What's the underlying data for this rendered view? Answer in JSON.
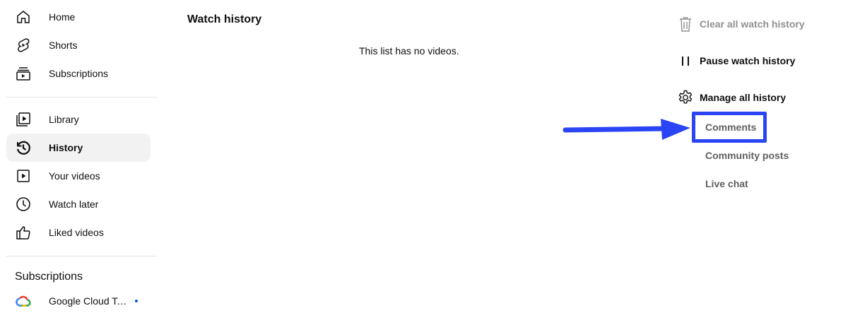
{
  "sidebar": {
    "primary": [
      {
        "label": "Home",
        "icon": "home-icon"
      },
      {
        "label": "Shorts",
        "icon": "shorts-icon"
      },
      {
        "label": "Subscriptions",
        "icon": "subscriptions-icon"
      }
    ],
    "library": [
      {
        "label": "Library",
        "icon": "library-icon"
      },
      {
        "label": "History",
        "icon": "history-icon",
        "active": true
      },
      {
        "label": "Your videos",
        "icon": "your-videos-icon"
      },
      {
        "label": "Watch later",
        "icon": "watch-later-icon"
      },
      {
        "label": "Liked videos",
        "icon": "liked-videos-icon"
      }
    ],
    "subscriptions_title": "Subscriptions",
    "subscriptions": [
      {
        "label": "Google Cloud Te…",
        "icon": "google-cloud-icon",
        "live_dot_color": "#065fd4"
      }
    ]
  },
  "main": {
    "title": "Watch history",
    "empty_message": "This list has no videos."
  },
  "actions": {
    "clear": {
      "label": "Clear all watch history",
      "icon": "trash-icon",
      "disabled": true
    },
    "pause": {
      "label": "Pause watch history",
      "icon": "pause-icon"
    },
    "manage": {
      "label": "Manage all history",
      "icon": "gear-icon"
    },
    "sub_links": [
      {
        "label": "Comments",
        "highlighted": true
      },
      {
        "label": "Community posts"
      },
      {
        "label": "Live chat"
      }
    ]
  },
  "annotation": {
    "color": "#2a45f5"
  }
}
